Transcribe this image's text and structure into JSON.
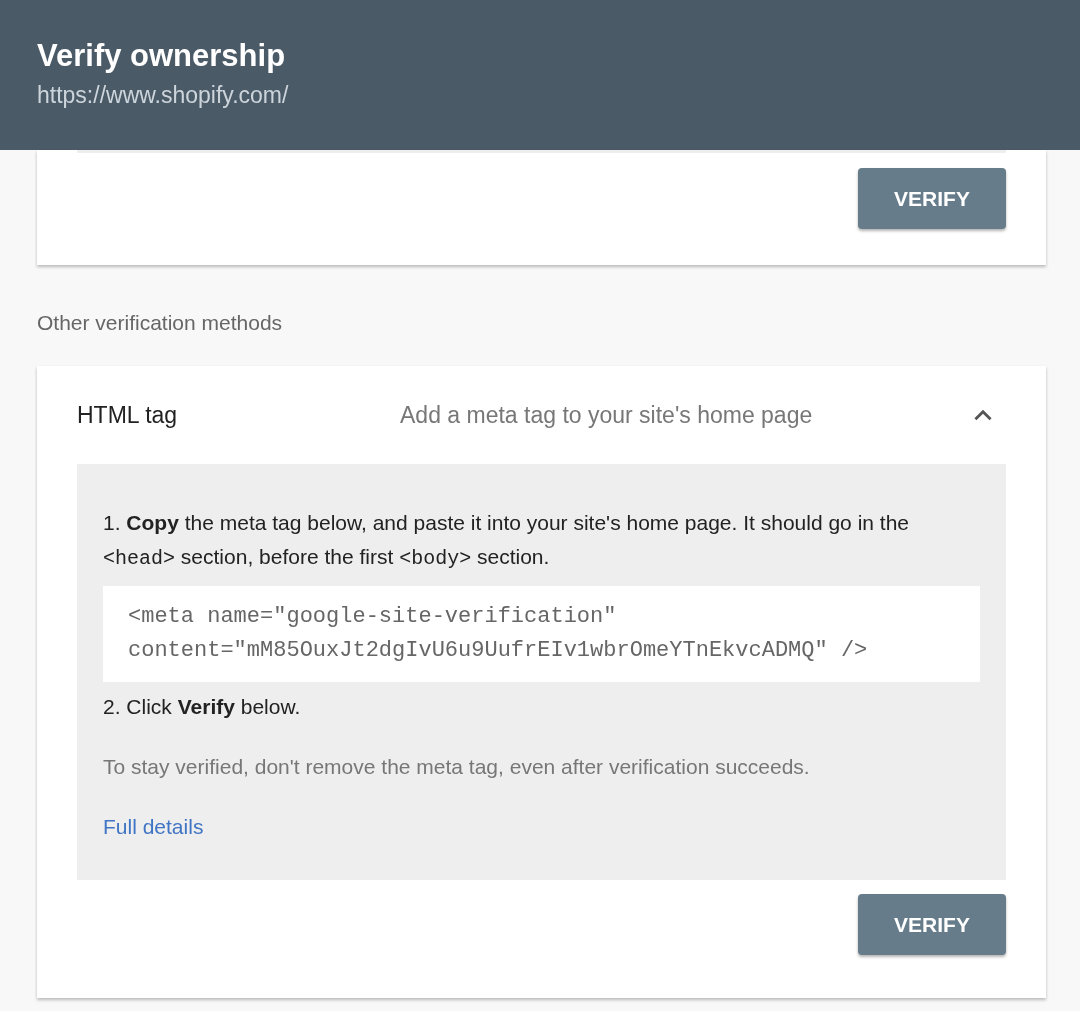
{
  "header": {
    "title": "Verify ownership",
    "url": "https://www.shopify.com/"
  },
  "top_card": {
    "button": "VERIFY"
  },
  "section_label": "Other verification methods",
  "method": {
    "name": "HTML tag",
    "description": "Add a meta tag to your site's home page",
    "expanded": true,
    "step_1": [
      {
        "kind": "text",
        "text": "1. **Copy** the meta tag below, and paste it into your site's home page. It should go in the "
      },
      {
        "kind": "code",
        "text": "<head>"
      },
      {
        "kind": "text",
        "text": " section, before the first "
      },
      {
        "kind": "code",
        "text": "<body>"
      },
      {
        "kind": "text",
        "text": " section."
      }
    ],
    "code_lines": [
      "<meta name=\"google-site-verification\"",
      "content=\"mM85OuxJt2dgIvU6u9UufrEIv1wbrOmeYTnEkvcADMQ\" />"
    ],
    "step_2": "2. Click **Verify** below.",
    "note": "To stay verified, don't remove the meta tag, even after verification succeeds.",
    "link": "Full details",
    "button": "VERIFY"
  }
}
